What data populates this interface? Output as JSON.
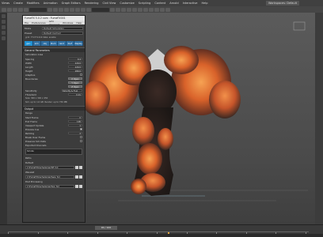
{
  "menubar": {
    "items": [
      "Views",
      "Create",
      "Modifiers",
      "Animation",
      "Graph Editors",
      "Rendering",
      "Civil View",
      "Customize",
      "Scripting",
      "Content",
      "Arnold",
      "Interactive",
      "Help"
    ],
    "workspace": "Workspaces: Default"
  },
  "viewport": {
    "label": "[+] [Perspective] [Standard] [Default Shading]"
  },
  "panel": {
    "title": "FumeFX 5.0.2 com : FumeFX001",
    "menu": [
      "File",
      "Preferences",
      "GPU Viewport",
      "Windows",
      "Help"
    ],
    "mode_label": "Mode",
    "mode_value": "Default Simulation",
    "preset_label": "Preset",
    "preset_value": "Default Cached",
    "grid_info": "grid: 77x77x110  data: enable",
    "tabs": [
      "gen",
      "sim",
      "obj",
      "illum",
      "rend",
      "ibuf",
      "display"
    ],
    "general_section": "General Parameters",
    "sim_area_label": "Simulation Area",
    "params": [
      {
        "label": "Spacing",
        "value": "0.4"
      },
      {
        "label": "Width",
        "value": "120.0"
      },
      {
        "label": "Length",
        "value": "120.0"
      },
      {
        "label": "Height",
        "value": "180.0"
      },
      {
        "label": "Adaptive",
        "value": ""
      },
      {
        "label": "Boundaries",
        "value": "X Open"
      },
      {
        "label": "",
        "value": "Y Open"
      },
      {
        "label": "",
        "value": "Z Open"
      },
      {
        "label": "Sensitivity",
        "value": "Velocity & Fuel"
      },
      {
        "label": "Threshold",
        "value": "0.01"
      }
    ],
    "size_note": "Size: 300 x 300 x 450",
    "sim_note": "Sim. up to 1.0 GB",
    "render_note": "Render: up to 750 MB",
    "output_section": "Output",
    "range_label": "Range",
    "range": [
      {
        "label": "Start Frame",
        "value": "0"
      },
      {
        "label": "End Frame",
        "value": "100"
      },
      {
        "label": "Viewport Update",
        "value": "1"
      },
      {
        "label": "Preview Cue",
        "value": ""
      },
      {
        "label": "Padding",
        "value": "4"
      }
    ],
    "checks": [
      {
        "label": "Break Over Frame",
        "on": false
      },
      {
        "label": "Preserve Sim Data",
        "on": false
      }
    ],
    "channels_label": "Exported Channels",
    "channels_value": "Smoke",
    "paths_label": "Paths",
    "default_label": "Default",
    "default_path": "C:\\FumeFX\\Cache\\project\\ff_fxd",
    "wavelet_label": "Wavelet",
    "wavelet_path": "C:\\FumeFX\\Cache\\project\\ww_fxd",
    "post_label": "Post Processing",
    "post_path": "C:\\FumeFX\\Cache\\project\\pp_fxd"
  },
  "timeline": {
    "slider_label": "90 / 100",
    "ticks": [
      "0",
      "10",
      "20",
      "30",
      "40",
      "50",
      "60",
      "70",
      "80",
      "90",
      "100"
    ]
  },
  "colors": {
    "accent": "#1f90d2",
    "smoke_dark": "#3a2a22",
    "fire": "#e2742a"
  }
}
